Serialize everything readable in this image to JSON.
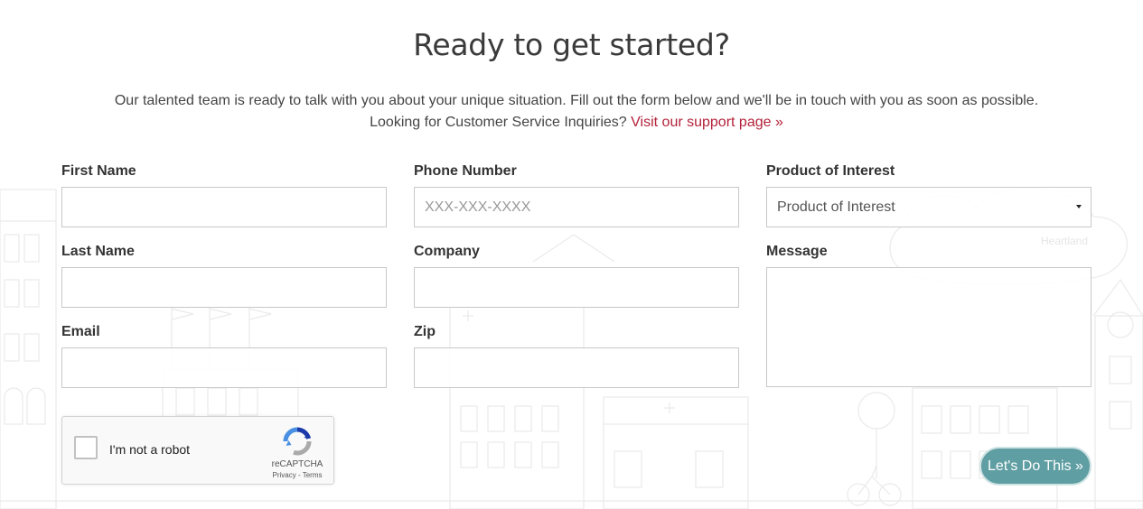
{
  "header": {
    "title": "Ready to get started?",
    "intro_line1": "Our talented team is ready to talk with you about your unique situation. Fill out the form below and we'll be in touch with you as soon as possible.",
    "intro_line2": "Looking for Customer Service Inquiries?",
    "support_link": "Visit our support page »"
  },
  "form": {
    "first_name": {
      "label": "First Name",
      "value": "",
      "placeholder": ""
    },
    "last_name": {
      "label": "Last Name",
      "value": "",
      "placeholder": ""
    },
    "email": {
      "label": "Email",
      "value": "",
      "placeholder": ""
    },
    "phone": {
      "label": "Phone Number",
      "value": "",
      "placeholder": "XXX-XXX-XXXX"
    },
    "company": {
      "label": "Company",
      "value": "",
      "placeholder": ""
    },
    "zip": {
      "label": "Zip",
      "value": "",
      "placeholder": ""
    },
    "product": {
      "label": "Product of Interest",
      "selected": "Product of Interest"
    },
    "message": {
      "label": "Message",
      "value": ""
    },
    "submit_label": "Let's Do This »"
  },
  "recaptcha": {
    "label": "I'm not a robot",
    "brand": "reCAPTCHA",
    "links": "Privacy - Terms"
  },
  "background": {
    "sign_text": "Heartland"
  },
  "colors": {
    "link": "#b3223a",
    "button": "#5f9ea2",
    "title": "#3a3a3a"
  }
}
